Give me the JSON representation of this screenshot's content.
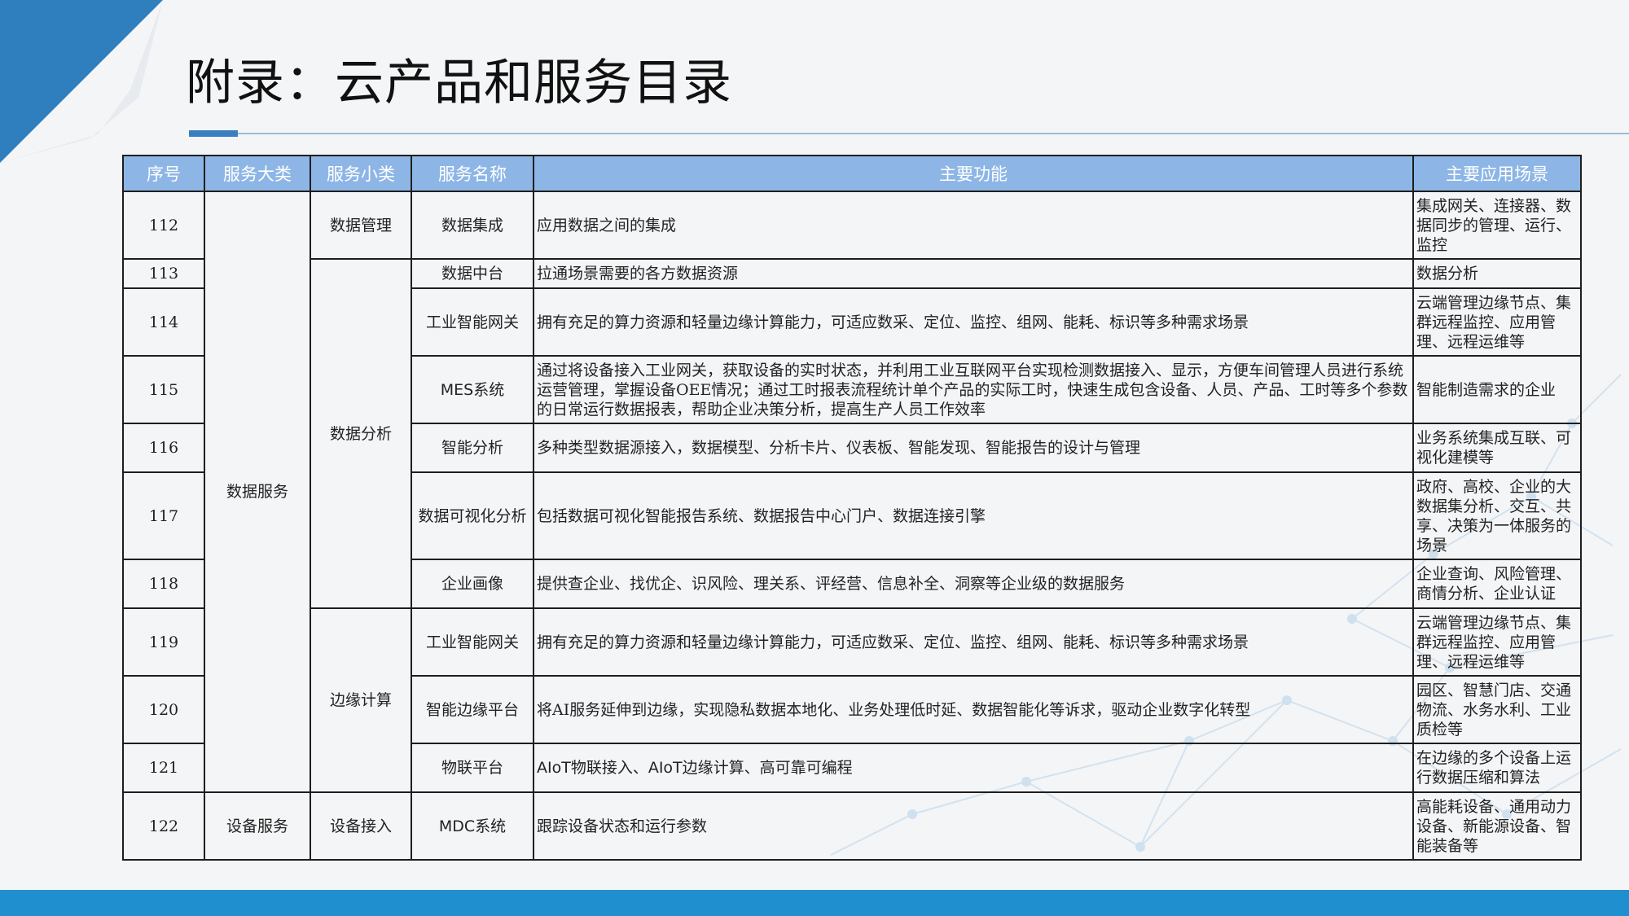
{
  "title": "附录：云产品和服务目录",
  "table": {
    "headers": [
      "序号",
      "服务大类",
      "服务小类",
      "服务名称",
      "主要功能",
      "主要应用场景"
    ],
    "categories": [
      {
        "label": "数据服务"
      },
      {
        "label": "设备服务"
      }
    ],
    "subcategories": [
      {
        "label": "数据管理"
      },
      {
        "label": "数据分析"
      },
      {
        "label": "边缘计算"
      },
      {
        "label": "设备接入"
      }
    ],
    "rows": [
      {
        "no": "112",
        "name": "数据集成",
        "function": "应用数据之间的集成",
        "scenario": "集成网关、连接器、数据同步的管理、运行、监控"
      },
      {
        "no": "113",
        "name": "数据中台",
        "function": "拉通场景需要的各方数据资源",
        "scenario": "数据分析"
      },
      {
        "no": "114",
        "name": "工业智能网关",
        "function": "拥有充足的算力资源和轻量边缘计算能力，可适应数采、定位、监控、组网、能耗、标识等多种需求场景",
        "scenario": "云端管理边缘节点、集群远程监控、应用管理、远程运维等"
      },
      {
        "no": "115",
        "name": "MES系统",
        "function": "通过将设备接入工业网关，获取设备的实时状态，并利用工业互联网平台实现检测数据接入、显示，方便车间管理人员进行系统运营管理，掌握设备OEE情况；通过工时报表流程统计单个产品的实际工时，快速生成包含设备、人员、产品、工时等多个参数的日常运行数据报表，帮助企业决策分析，提高生产人员工作效率",
        "scenario": "智能制造需求的企业"
      },
      {
        "no": "116",
        "name": "智能分析",
        "function": "多种类型数据源接入，数据模型、分析卡片、仪表板、智能发现、智能报告的设计与管理",
        "scenario": "业务系统集成互联、可视化建模等"
      },
      {
        "no": "117",
        "name": "数据可视化分析",
        "function": "包括数据可视化智能报告系统、数据报告中心门户、数据连接引擎",
        "scenario": "政府、高校、企业的大数据集分析、交互、共享、决策为一体服务的场景"
      },
      {
        "no": "118",
        "name": "企业画像",
        "function": "提供查企业、找优企、识风险、理关系、评经营、信息补全、洞察等企业级的数据服务",
        "scenario": "企业查询、风险管理、商情分析、企业认证"
      },
      {
        "no": "119",
        "name": "工业智能网关",
        "function": "拥有充足的算力资源和轻量边缘计算能力，可适应数采、定位、监控、组网、能耗、标识等多种需求场景",
        "scenario": "云端管理边缘节点、集群远程监控、应用管理、远程运维等"
      },
      {
        "no": "120",
        "name": "智能边缘平台",
        "function": "将AI服务延伸到边缘，实现隐私数据本地化、业务处理低时延、数据智能化等诉求，驱动企业数字化转型",
        "scenario": "园区、智慧门店、交通物流、水务水利、工业质检等"
      },
      {
        "no": "121",
        "name": "物联平台",
        "function": "AIoT物联接入、AIoT边缘计算、高可靠可编程",
        "scenario": "在边缘的多个设备上运行数据压缩和算法"
      },
      {
        "no": "122",
        "name": "MDC系统",
        "function": "跟踪设备状态和运行参数",
        "scenario": "高能耗设备、通用动力设备、新能源设备、智能装备等"
      }
    ]
  }
}
